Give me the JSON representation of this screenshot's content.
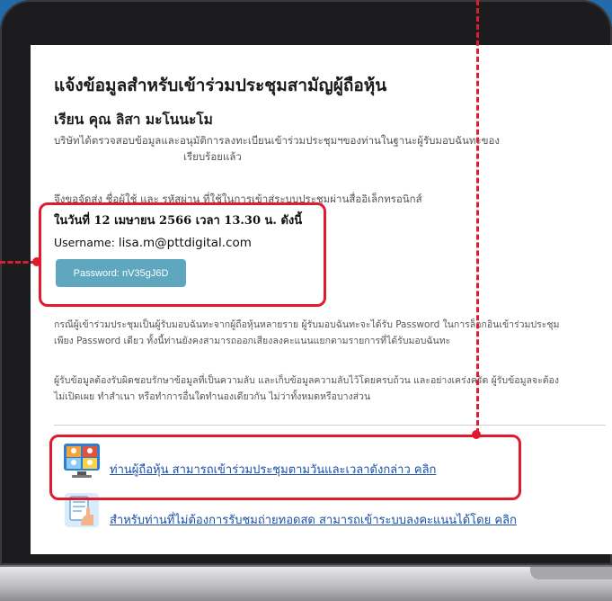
{
  "email": {
    "heading": "แจ้งข้อมูลสำหรับเข้าร่วมประชุมสามัญผู้ถือหุ้น",
    "greeting": "เรียน คุณ ลิสา มะโนนะโม",
    "verify_line1": "บริษัทได้ตรวจสอบข้อมูลและอนุมัติการลงทะเบียนเข้าร่วมประชุมฯของท่านในฐานะผู้รับมอบฉันทะของ",
    "verify_line2": "เรียบร้อยแล้ว",
    "delivery_line": "จึงขอจัดส่ง ชื่อผู้ใช้ และ รหัสผ่าน ที่ใช้ในการเข้าสู่ระบบประชุมผ่านสื่ออิเล็กทรอนิกส์",
    "date_line": "ในวันที่ 12 เมษายน 2566 เวลา 13.30 น. ดังนี้",
    "username_label": "Username:",
    "username_value": "lisa.m@pttdigital.com",
    "password_button": "Password: nV35gJ6D",
    "proxy_note_line1": "กรณีผู้เข้าร่วมประชุมเป็นผู้รับมอบฉันทะจากผู้ถือหุ้นหลายราย ผู้รับมอบฉันทะจะได้รับ Password ในการล็อกอินเข้าร่วมประชุม",
    "proxy_note_line2": "เพียง Password เดียว ทั้งนี้ท่านยังคงสามารถออกเสียงลงคะแนนแยกตามรายการที่ได้รับมอบฉันทะ",
    "privacy_line1": "ผู้รับข้อมูลต้องรับผิดชอบรักษาข้อมูลที่เป็นความลับ และเก็บข้อมูลความลับไว้โดยครบถ้วน และอย่างเคร่งครัด ผู้รับข้อมูลจะต้อง",
    "privacy_line2": "ไม่เปิดเผย ทำสำเนา หรือทำการอื่นใดทำนองเดียวกัน ไม่ว่าทั้งหมดหรือบางส่วน",
    "link_join": "ท่านผู้ถือหุ้น สามารถเข้าร่วมประชุมตามวันและเวลาดังกล่าว คลิก",
    "link_vote": "สำหรับท่านที่ไม่ต้องการรับชมถ่ายทอดสด สามารถเข้าระบบลงคะแนนได้โดย คลิก"
  },
  "icons": [
    "video-meeting-icon",
    "voting-hand-icon"
  ],
  "colors": {
    "highlight": "#e01b2e",
    "button": "#5ea7bf",
    "link": "#1a4fa8",
    "background": "#2e86c9"
  }
}
